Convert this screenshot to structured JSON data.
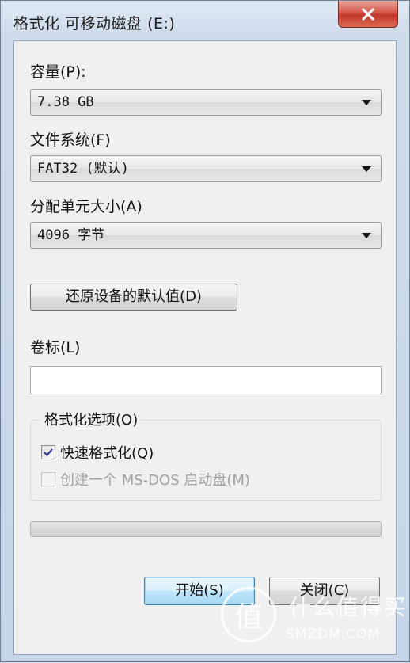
{
  "window": {
    "title": "格式化 可移动磁盘 (E:)"
  },
  "capacity": {
    "label": "容量(P):",
    "value": "7.38 GB"
  },
  "filesystem": {
    "label": "文件系统(F)",
    "value": "FAT32 (默认)"
  },
  "allocation": {
    "label": "分配单元大小(A)",
    "value": "4096 字节"
  },
  "restore_button": {
    "label": "还原设备的默认值(D)"
  },
  "volume": {
    "label": "卷标(L)",
    "value": ""
  },
  "format_options": {
    "title": "格式化选项(O)",
    "quick_format": {
      "label": "快速格式化(Q)",
      "checked": true
    },
    "msdos_disk": {
      "label": "创建一个 MS-DOS 启动盘(M)",
      "checked": false,
      "enabled": false
    }
  },
  "progress": {
    "value": 0
  },
  "buttons": {
    "start": "开始(S)",
    "close": "关闭(C)"
  },
  "watermark": {
    "glyph": "值",
    "text": "什么值得买",
    "sub": "SMZDM.COM"
  },
  "colors": {
    "close_button": "#c2362b",
    "window_frame": "#cfdcea",
    "dialog_face": "#f0f0f0"
  }
}
